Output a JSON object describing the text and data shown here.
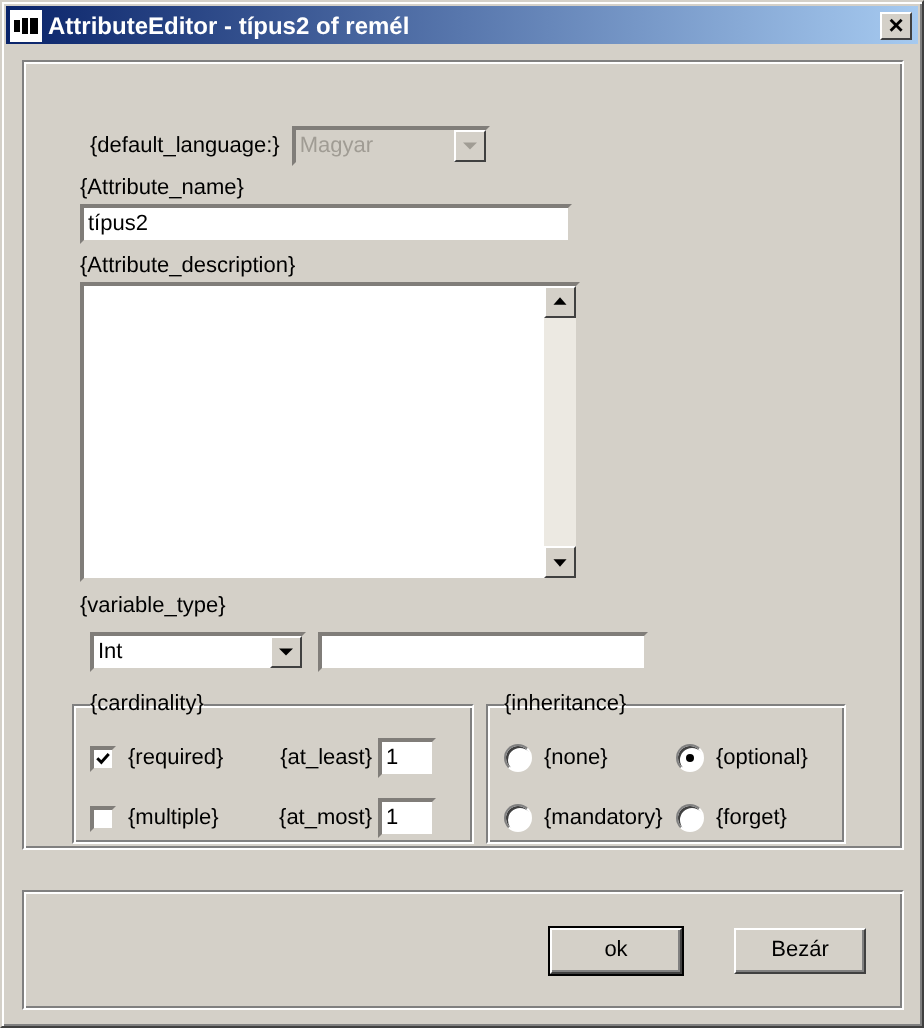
{
  "window": {
    "title": "AttributeEditor - típus2 of remél",
    "close": "×"
  },
  "default_language": {
    "label": "{default_language:}",
    "value": "Magyar",
    "disabled": true
  },
  "attribute_name": {
    "label": "{Attribute_name}",
    "value": "típus2"
  },
  "attribute_description": {
    "label": "{Attribute_description}"
  },
  "variable_type": {
    "label": "{variable_type}",
    "value": "Int"
  },
  "cardinality": {
    "title": "{cardinality}",
    "rows": [
      {
        "label": "{required}",
        "checked": true,
        "bound_label": "{at_least}",
        "bound_value": "1"
      },
      {
        "label": "{multiple}",
        "checked": false,
        "bound_label": "{at_most}",
        "bound_value": "1"
      }
    ]
  },
  "inheritance": {
    "title": "{inheritance}",
    "options": [
      {
        "label": "{none}",
        "selected": false
      },
      {
        "label": "{optional}",
        "selected": true
      },
      {
        "label": "{mandatory}",
        "selected": false
      },
      {
        "label": "{forget}",
        "selected": false
      }
    ]
  },
  "buttons": [
    "ok",
    "Bezár"
  ]
}
